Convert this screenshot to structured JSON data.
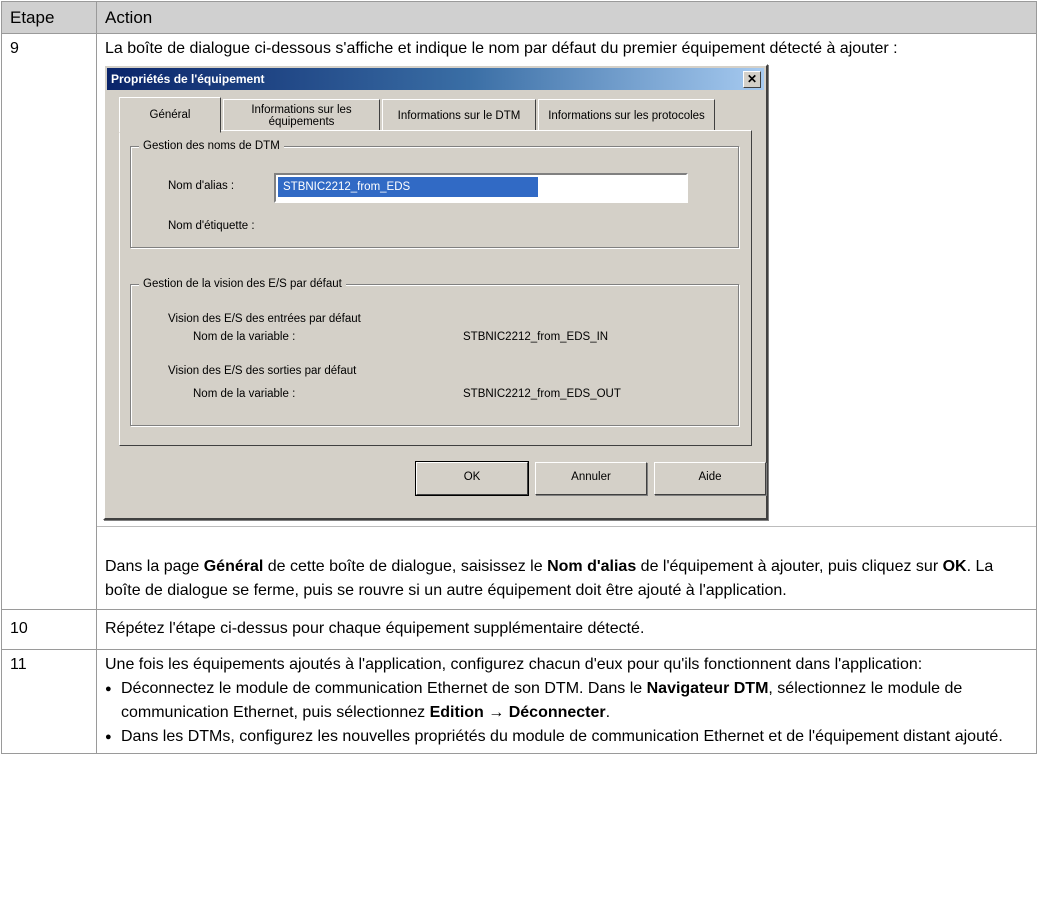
{
  "table": {
    "headers": {
      "step": "Etape",
      "action": "Action"
    },
    "rows": [
      {
        "step": "9",
        "intro": "La boîte de dialogue ci-dessous s'affiche et indique le nom par défaut du premier équipement détecté à ajouter :",
        "outro": {
          "p1": "Dans la page ",
          "b1": "Général",
          "p2": " de cette boîte de dialogue, saisissez le ",
          "b2": "Nom d'alias",
          "p3": " de l'équipement à ajouter, puis cliquez sur ",
          "b3": "OK",
          "p4": ". La boîte de dialogue se ferme, puis se rouvre si un autre équipement doit être ajouté à l'application."
        }
      },
      {
        "step": "10",
        "text": "Répétez l'étape ci-dessus pour chaque équipement supplémentaire détecté."
      },
      {
        "step": "11",
        "intro": "Une fois les équipements ajoutés à l'application, configurez chacun d'eux pour qu'ils fonctionnent dans l'application:",
        "bullet1": {
          "p1": "Déconnectez le module de communication Ethernet de son DTM. Dans le ",
          "b1": "Navigateur DTM",
          "p2": ", sélectionnez le module de communication Ethernet, puis sélectionnez ",
          "b2": "Edition → Déconnecter",
          "p3": "."
        },
        "bullet2": "Dans les DTMs, configurez les nouvelles propriétés du module de communication Ethernet et de l'équipement distant ajouté."
      }
    ]
  },
  "dialog": {
    "title": "Propriétés de l'équipement",
    "close_label": "✕",
    "tabs": [
      "Général",
      "Informations sur les équipements",
      "Informations sur le DTM",
      "Informations sur les protocoles"
    ],
    "group1": {
      "legend": "Gestion des noms de DTM",
      "alias_label": "Nom d'alias :",
      "alias_value": "STBNIC2212_from_EDS",
      "tag_label": "Nom d'étiquette :"
    },
    "group2": {
      "legend": "Gestion de la vision des E/S par défaut",
      "inputs_label": "Vision des E/S des entrées par défaut",
      "inputs_var_label": "Nom de la variable :",
      "inputs_var_value": "STBNIC2212_from_EDS_IN",
      "outputs_label": "Vision des E/S des sorties par défaut",
      "outputs_var_label": "Nom de la variable :",
      "outputs_var_value": "STBNIC2212_from_EDS_OUT"
    },
    "buttons": {
      "ok": "OK",
      "cancel": "Annuler",
      "help": "Aide"
    }
  }
}
